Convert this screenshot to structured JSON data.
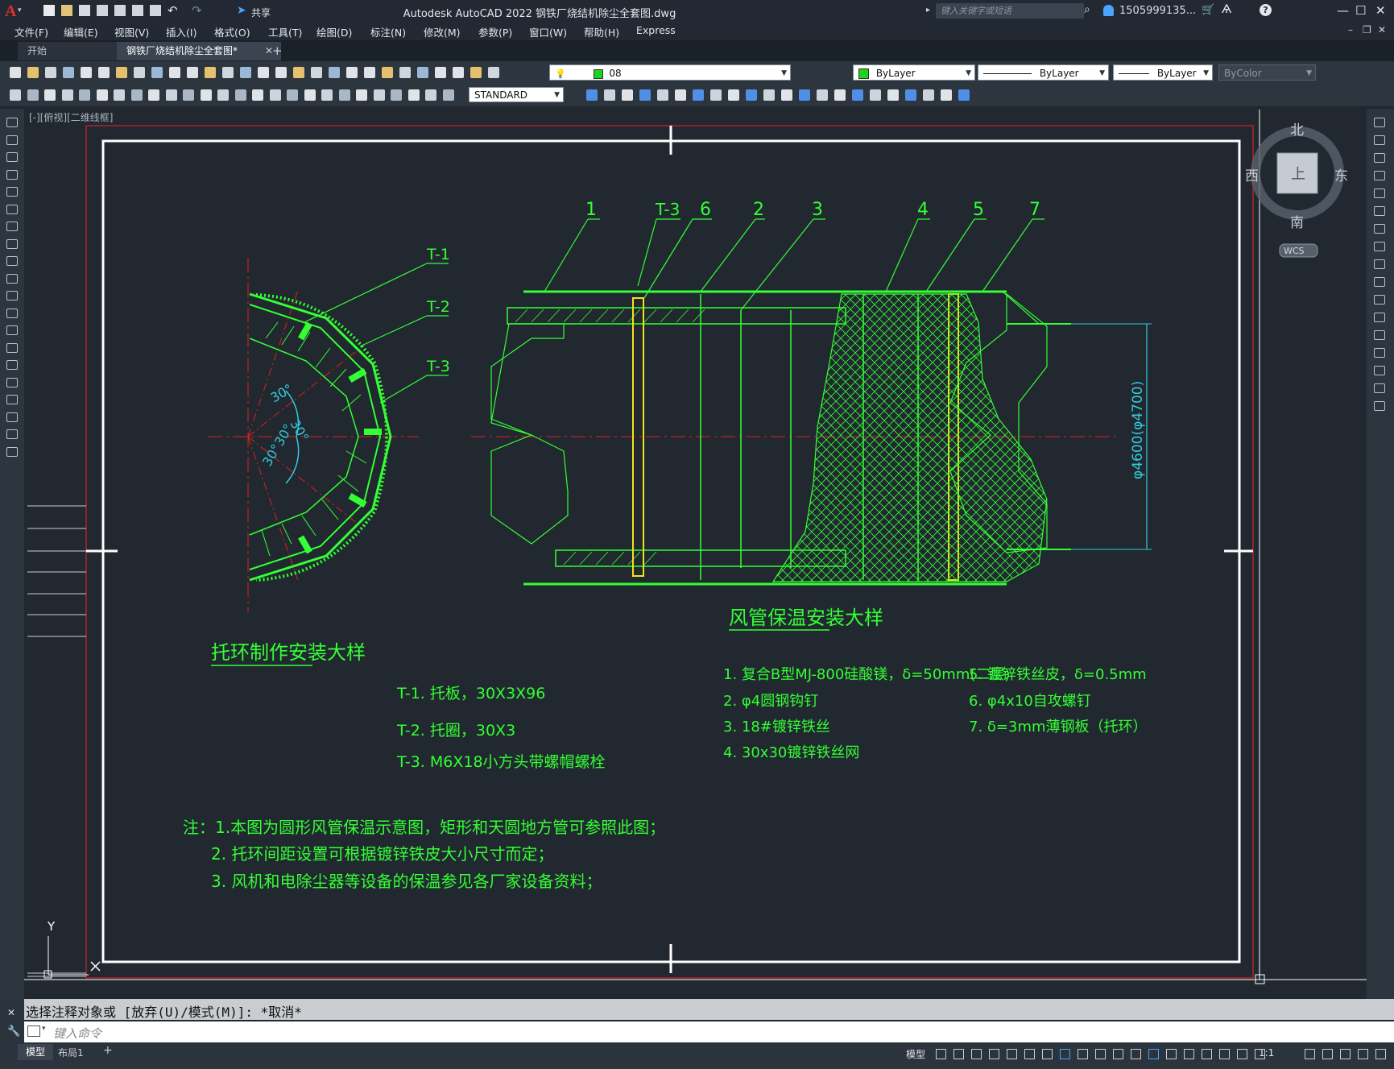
{
  "app": {
    "title": "Autodesk AutoCAD 2022    钢铁厂烧结机除尘全套图.dwg",
    "share": "共享",
    "search_placeholder": "键入关键字或短语",
    "user": "1505999135..."
  },
  "menu": [
    "文件(F)",
    "编辑(E)",
    "视图(V)",
    "插入(I)",
    "格式(O)",
    "工具(T)",
    "绘图(D)",
    "标注(N)",
    "修改(M)",
    "参数(P)",
    "窗口(W)",
    "帮助(H)",
    "Express"
  ],
  "tabs": {
    "start": "开始",
    "doc": "钢铁厂烧结机除尘全套图*"
  },
  "toolbar": {
    "layer_value": "08",
    "color_value": "ByLayer",
    "linetype_value": "ByLayer",
    "lineweight_value": "ByLayer",
    "plotstyle_value": "ByColor",
    "textstyle_value": "STANDARD"
  },
  "viewport_label": "[-][俯视][二维线框]",
  "viewcube": {
    "north": "北",
    "south": "南",
    "east": "东",
    "west": "西",
    "face": "上",
    "wcs": "WCS"
  },
  "ucs_y": "Y",
  "drawing": {
    "left_title": "托环制作安装大样",
    "right_title": "风管保温安装大样",
    "callouts_top": [
      "1",
      "T-3",
      "6",
      "2",
      "3",
      "4",
      "5",
      "7"
    ],
    "callouts_left": [
      "T-1",
      "T-2",
      "T-3"
    ],
    "angles": [
      "30°",
      "30°",
      "30°",
      "30°"
    ],
    "dimension": "φ4600(φ4700)",
    "parts_left": [
      "T-1. 托板，30X3X96",
      "T-2. 托圈，30X3",
      "T-3. M6X18小方头带螺帽螺栓"
    ],
    "parts_mid": [
      "1. 复合B型MJ-800硅酸镁，δ=50mm(二层)",
      "2. φ4圆钢钩钉",
      "3. 18#镀锌铁丝",
      "4. 30x30镀锌铁丝网"
    ],
    "parts_right": [
      "5. 镀锌铁丝皮，δ=0.5mm",
      "6. φ4x10自攻螺钉",
      "7. δ=3mm薄钢板（托环）"
    ],
    "notes": [
      "注：1.本图为圆形风管保温示意图，矩形和天圆地方管可参照此图；",
      "2. 托环间距设置可根据镀锌铁皮大小尺寸而定；",
      "3. 风机和电除尘器等设备的保温参见各厂家设备资料；"
    ]
  },
  "command": {
    "history": "选择注释对象或 [放弃(U)/模式(M)]: *取消*",
    "placeholder": "键入命令"
  },
  "status": {
    "model_tab": "模型",
    "layout_tab": "布局1",
    "add": "+",
    "model_btn": "模型",
    "scale": "1:1"
  }
}
